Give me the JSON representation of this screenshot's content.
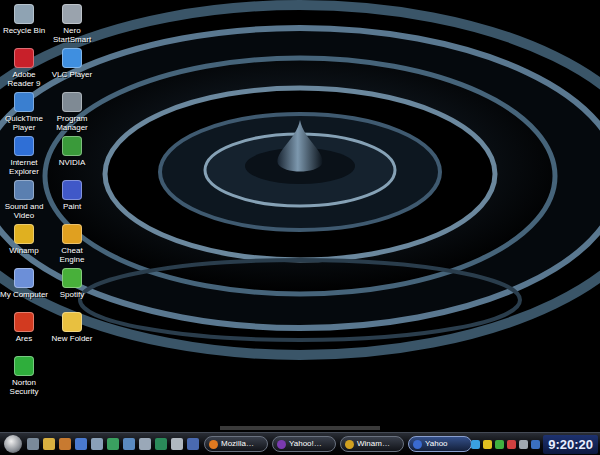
{
  "desktop_icons": [
    {
      "label": "Recycle Bin",
      "color": "#8fa3b3"
    },
    {
      "label": "Adobe Reader 9",
      "color": "#c8202a"
    },
    {
      "label": "QuickTime Player",
      "color": "#3a7fd0"
    },
    {
      "label": "Internet Explorer",
      "color": "#2f6fd6"
    },
    {
      "label": "Sound and Video",
      "color": "#5a7fb0"
    },
    {
      "label": "Winamp",
      "color": "#e0b020"
    },
    {
      "label": "My Computer",
      "color": "#6c8fd8"
    },
    {
      "label": "Ares",
      "color": "#d23a20"
    },
    {
      "label": "Norton Security",
      "color": "#2fae3c"
    },
    {
      "label": "Nero StartSmart",
      "color": "#9aa3ad"
    },
    {
      "label": "VLC Player",
      "color": "#3f8fe0"
    },
    {
      "label": "Program Manager",
      "color": "#7f8a94"
    },
    {
      "label": "NVIDIA",
      "color": "#3a9a3a"
    },
    {
      "label": "Paint",
      "color": "#4058c8"
    },
    {
      "label": "Cheat Engine",
      "color": "#e0a020"
    },
    {
      "label": "Spotify",
      "color": "#48b03a"
    },
    {
      "label": "New Folder",
      "color": "#e8c040"
    }
  ],
  "quick_launch": [
    {
      "color": "#7a8a9a"
    },
    {
      "color": "#d9b040"
    },
    {
      "color": "#c87a30"
    },
    {
      "color": "#4a7ad0"
    },
    {
      "color": "#8aa0b8"
    },
    {
      "color": "#3aa060"
    },
    {
      "color": "#5a8ac0"
    },
    {
      "color": "#9aa8b8"
    },
    {
      "color": "#2a8a5a"
    },
    {
      "color": "#b0b8c0"
    },
    {
      "color": "#4a6ab0"
    }
  ],
  "tasks": [
    {
      "label": "Mozilla…",
      "selected": false,
      "color": "#e07a20"
    },
    {
      "label": "Yahoo!…",
      "selected": false,
      "color": "#7a3ab0"
    },
    {
      "label": "Winam…",
      "selected": false,
      "color": "#d0a020"
    },
    {
      "label": "Yahoo",
      "selected": true,
      "color": "#3a6ad0"
    }
  ],
  "tray_icons": [
    {
      "color": "#3aa0e0"
    },
    {
      "color": "#e0c020"
    },
    {
      "color": "#40b040"
    },
    {
      "color": "#d04040"
    },
    {
      "color": "#a0a8b0"
    },
    {
      "color": "#3a70c0"
    }
  ],
  "clock": "9:20:20"
}
